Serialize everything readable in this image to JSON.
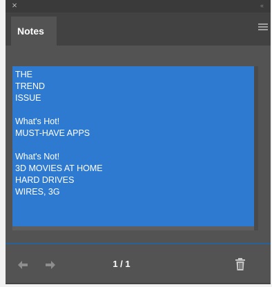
{
  "window": {
    "close_symbol": "×",
    "collapse_symbol": "‹‹"
  },
  "tab": {
    "label": "Notes"
  },
  "note": {
    "lines": [
      "THE",
      "TREND",
      "ISSUE",
      "",
      "What's Hot!",
      "MUST-HAVE APPS",
      "",
      "What's Not!",
      "3D MOVIES AT HOME",
      "HARD DRIVES",
      "WIRES, 3G"
    ],
    "selection_color": "#2f7ad1"
  },
  "footer": {
    "page_counter": "1 / 1",
    "prev_icon": "left-arrow-icon",
    "next_icon": "right-arrow-icon",
    "delete_icon": "trash-icon"
  },
  "colors": {
    "panel_bg": "#535353",
    "tab_strip_bg": "#424242",
    "accent_divider": "#2b5f97"
  }
}
